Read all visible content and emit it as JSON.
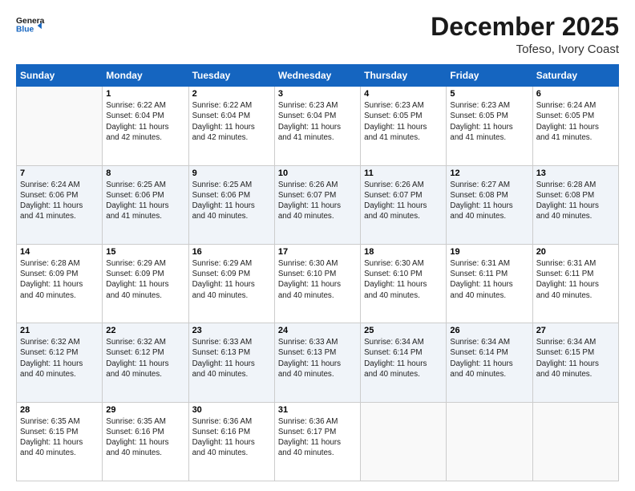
{
  "logo": {
    "line1": "General",
    "line2": "Blue"
  },
  "title": "December 2025",
  "subtitle": "Tofeso, Ivory Coast",
  "days_header": [
    "Sunday",
    "Monday",
    "Tuesday",
    "Wednesday",
    "Thursday",
    "Friday",
    "Saturday"
  ],
  "weeks": [
    [
      {
        "num": "",
        "detail": ""
      },
      {
        "num": "1",
        "detail": "Sunrise: 6:22 AM\nSunset: 6:04 PM\nDaylight: 11 hours\nand 42 minutes."
      },
      {
        "num": "2",
        "detail": "Sunrise: 6:22 AM\nSunset: 6:04 PM\nDaylight: 11 hours\nand 42 minutes."
      },
      {
        "num": "3",
        "detail": "Sunrise: 6:23 AM\nSunset: 6:04 PM\nDaylight: 11 hours\nand 41 minutes."
      },
      {
        "num": "4",
        "detail": "Sunrise: 6:23 AM\nSunset: 6:05 PM\nDaylight: 11 hours\nand 41 minutes."
      },
      {
        "num": "5",
        "detail": "Sunrise: 6:23 AM\nSunset: 6:05 PM\nDaylight: 11 hours\nand 41 minutes."
      },
      {
        "num": "6",
        "detail": "Sunrise: 6:24 AM\nSunset: 6:05 PM\nDaylight: 11 hours\nand 41 minutes."
      }
    ],
    [
      {
        "num": "7",
        "detail": "Sunrise: 6:24 AM\nSunset: 6:06 PM\nDaylight: 11 hours\nand 41 minutes."
      },
      {
        "num": "8",
        "detail": "Sunrise: 6:25 AM\nSunset: 6:06 PM\nDaylight: 11 hours\nand 41 minutes."
      },
      {
        "num": "9",
        "detail": "Sunrise: 6:25 AM\nSunset: 6:06 PM\nDaylight: 11 hours\nand 40 minutes."
      },
      {
        "num": "10",
        "detail": "Sunrise: 6:26 AM\nSunset: 6:07 PM\nDaylight: 11 hours\nand 40 minutes."
      },
      {
        "num": "11",
        "detail": "Sunrise: 6:26 AM\nSunset: 6:07 PM\nDaylight: 11 hours\nand 40 minutes."
      },
      {
        "num": "12",
        "detail": "Sunrise: 6:27 AM\nSunset: 6:08 PM\nDaylight: 11 hours\nand 40 minutes."
      },
      {
        "num": "13",
        "detail": "Sunrise: 6:28 AM\nSunset: 6:08 PM\nDaylight: 11 hours\nand 40 minutes."
      }
    ],
    [
      {
        "num": "14",
        "detail": "Sunrise: 6:28 AM\nSunset: 6:09 PM\nDaylight: 11 hours\nand 40 minutes."
      },
      {
        "num": "15",
        "detail": "Sunrise: 6:29 AM\nSunset: 6:09 PM\nDaylight: 11 hours\nand 40 minutes."
      },
      {
        "num": "16",
        "detail": "Sunrise: 6:29 AM\nSunset: 6:09 PM\nDaylight: 11 hours\nand 40 minutes."
      },
      {
        "num": "17",
        "detail": "Sunrise: 6:30 AM\nSunset: 6:10 PM\nDaylight: 11 hours\nand 40 minutes."
      },
      {
        "num": "18",
        "detail": "Sunrise: 6:30 AM\nSunset: 6:10 PM\nDaylight: 11 hours\nand 40 minutes."
      },
      {
        "num": "19",
        "detail": "Sunrise: 6:31 AM\nSunset: 6:11 PM\nDaylight: 11 hours\nand 40 minutes."
      },
      {
        "num": "20",
        "detail": "Sunrise: 6:31 AM\nSunset: 6:11 PM\nDaylight: 11 hours\nand 40 minutes."
      }
    ],
    [
      {
        "num": "21",
        "detail": "Sunrise: 6:32 AM\nSunset: 6:12 PM\nDaylight: 11 hours\nand 40 minutes."
      },
      {
        "num": "22",
        "detail": "Sunrise: 6:32 AM\nSunset: 6:12 PM\nDaylight: 11 hours\nand 40 minutes."
      },
      {
        "num": "23",
        "detail": "Sunrise: 6:33 AM\nSunset: 6:13 PM\nDaylight: 11 hours\nand 40 minutes."
      },
      {
        "num": "24",
        "detail": "Sunrise: 6:33 AM\nSunset: 6:13 PM\nDaylight: 11 hours\nand 40 minutes."
      },
      {
        "num": "25",
        "detail": "Sunrise: 6:34 AM\nSunset: 6:14 PM\nDaylight: 11 hours\nand 40 minutes."
      },
      {
        "num": "26",
        "detail": "Sunrise: 6:34 AM\nSunset: 6:14 PM\nDaylight: 11 hours\nand 40 minutes."
      },
      {
        "num": "27",
        "detail": "Sunrise: 6:34 AM\nSunset: 6:15 PM\nDaylight: 11 hours\nand 40 minutes."
      }
    ],
    [
      {
        "num": "28",
        "detail": "Sunrise: 6:35 AM\nSunset: 6:15 PM\nDaylight: 11 hours\nand 40 minutes."
      },
      {
        "num": "29",
        "detail": "Sunrise: 6:35 AM\nSunset: 6:16 PM\nDaylight: 11 hours\nand 40 minutes."
      },
      {
        "num": "30",
        "detail": "Sunrise: 6:36 AM\nSunset: 6:16 PM\nDaylight: 11 hours\nand 40 minutes."
      },
      {
        "num": "31",
        "detail": "Sunrise: 6:36 AM\nSunset: 6:17 PM\nDaylight: 11 hours\nand 40 minutes."
      },
      {
        "num": "",
        "detail": ""
      },
      {
        "num": "",
        "detail": ""
      },
      {
        "num": "",
        "detail": ""
      }
    ]
  ]
}
